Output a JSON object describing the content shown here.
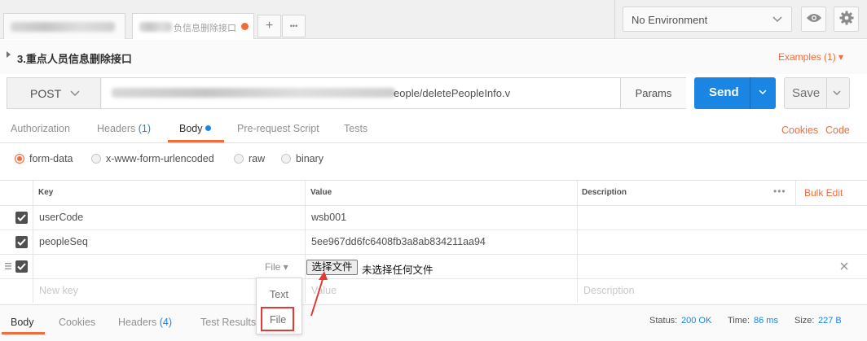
{
  "tabs": {
    "tab2_label": "负信息删除接口",
    "new_tab": "+",
    "more_tabs": "•••"
  },
  "environment": {
    "selected": "No Environment"
  },
  "request": {
    "title": "3.重点人员信息删除接口",
    "examples_label": "Examples (1) ▾",
    "method": "POST",
    "url_visible": "eople/deletePeopleInfo.v",
    "params_label": "Params",
    "send_label": "Send",
    "save_label": "Save"
  },
  "request_tabs": {
    "authorization": "Authorization",
    "headers": "Headers",
    "headers_count": "(1)",
    "body": "Body",
    "prerequest": "Pre-request Script",
    "tests": "Tests",
    "cookies": "Cookies",
    "code": "Code"
  },
  "body_types": {
    "form_data": "form-data",
    "urlencoded": "x-www-form-urlencoded",
    "raw": "raw",
    "binary": "binary"
  },
  "table": {
    "headers": {
      "key": "Key",
      "value": "Value",
      "description": "Description"
    },
    "bulk_edit": "Bulk Edit",
    "more": "•••",
    "rows": [
      {
        "key": "userCode",
        "value": "wsb001"
      },
      {
        "key": "peopleSeq",
        "value": "5ee967dd6fc6408fb3a8ab834211aa94"
      }
    ],
    "file_type_select": "File ▾",
    "choose_file_button": "选择文件",
    "no_file_text": "未选择任何文件",
    "placeholders": {
      "key": "New key",
      "value": "Value",
      "description": "Description"
    }
  },
  "type_dropdown": {
    "options": [
      "Text",
      "File"
    ]
  },
  "response_tabs": {
    "body": "Body",
    "cookies": "Cookies",
    "headers": "Headers",
    "headers_count": "(4)",
    "test_results": "Test Results"
  },
  "status": {
    "status_label": "Status:",
    "status_value": "200 OK",
    "time_label": "Time:",
    "time_value": "86 ms",
    "size_label": "Size:",
    "size_value": "227 B"
  },
  "colors": {
    "accent_orange": "#f26b3a",
    "send_blue": "#1a85e3",
    "highlight_red": "#e53935"
  }
}
